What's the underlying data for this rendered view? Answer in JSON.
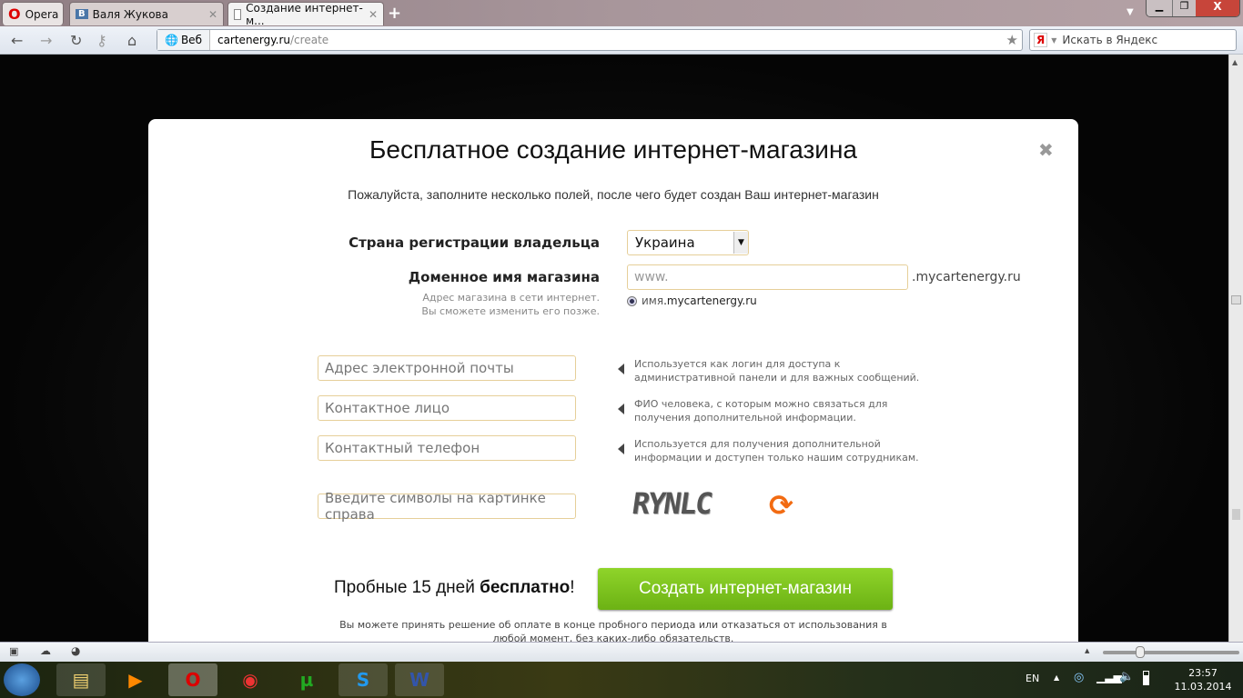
{
  "browser": {
    "opera_label": "Opera",
    "tabs": [
      {
        "label": "Валя Жукова",
        "icon": "vk-icon"
      },
      {
        "label": "Создание интернет-м...",
        "icon": "page-icon"
      }
    ],
    "web_label": "Веб",
    "url_host": "cartenergy.ru",
    "url_path": "/create",
    "search_placeholder": "Искать в Яндекс"
  },
  "modal": {
    "title": "Бесплатное создание интернет-магазина",
    "subtitle": "Пожалуйста, заполните несколько полей, после чего будет создан Ваш интернет-магазин",
    "country_label": "Страна регистрации владельца",
    "country_value": "Украина",
    "domain_label": "Доменное имя магазина",
    "domain_hint_1": "Адрес магазина в сети интернет.",
    "domain_hint_2": "Вы сможете изменить его позже.",
    "domain_placeholder": "www.",
    "domain_suffix": ".mycartenergy.ru",
    "domain_preview_prefix": "имя",
    "domain_preview_suffix": ".mycartenergy.ru",
    "fields": [
      {
        "placeholder": "Адрес электронной почты",
        "hint_1": "Используется как логин для доступа к",
        "hint_2": "административной панели и для важных сообщений."
      },
      {
        "placeholder": "Контактное лицо",
        "hint_1": "ФИО человека, с которым можно связаться для",
        "hint_2": "получения дополнительной информации."
      },
      {
        "placeholder": "Контактный телефон",
        "hint_1": "Используется для получения дополнительной",
        "hint_2": "информации и доступен только нашим сотрудникам."
      }
    ],
    "captcha_placeholder": "Введите символы на картинке справа",
    "captcha_text": "RYNLC",
    "trial_prefix": "Пробные 15 дней ",
    "trial_bold": "бесплатно",
    "trial_suffix": "!",
    "create_button": "Создать интернет-магазин",
    "footer_1": "Вы можете принять решение об оплате в конце пробного периода или отказаться от использования в",
    "footer_2": "любой момент, без каких-либо обязательств.",
    "accent_color": "#7cc21e",
    "refresh_color": "#f26b12"
  },
  "tray": {
    "lang": "EN",
    "time": "23:57",
    "date": "11.03.2014"
  }
}
